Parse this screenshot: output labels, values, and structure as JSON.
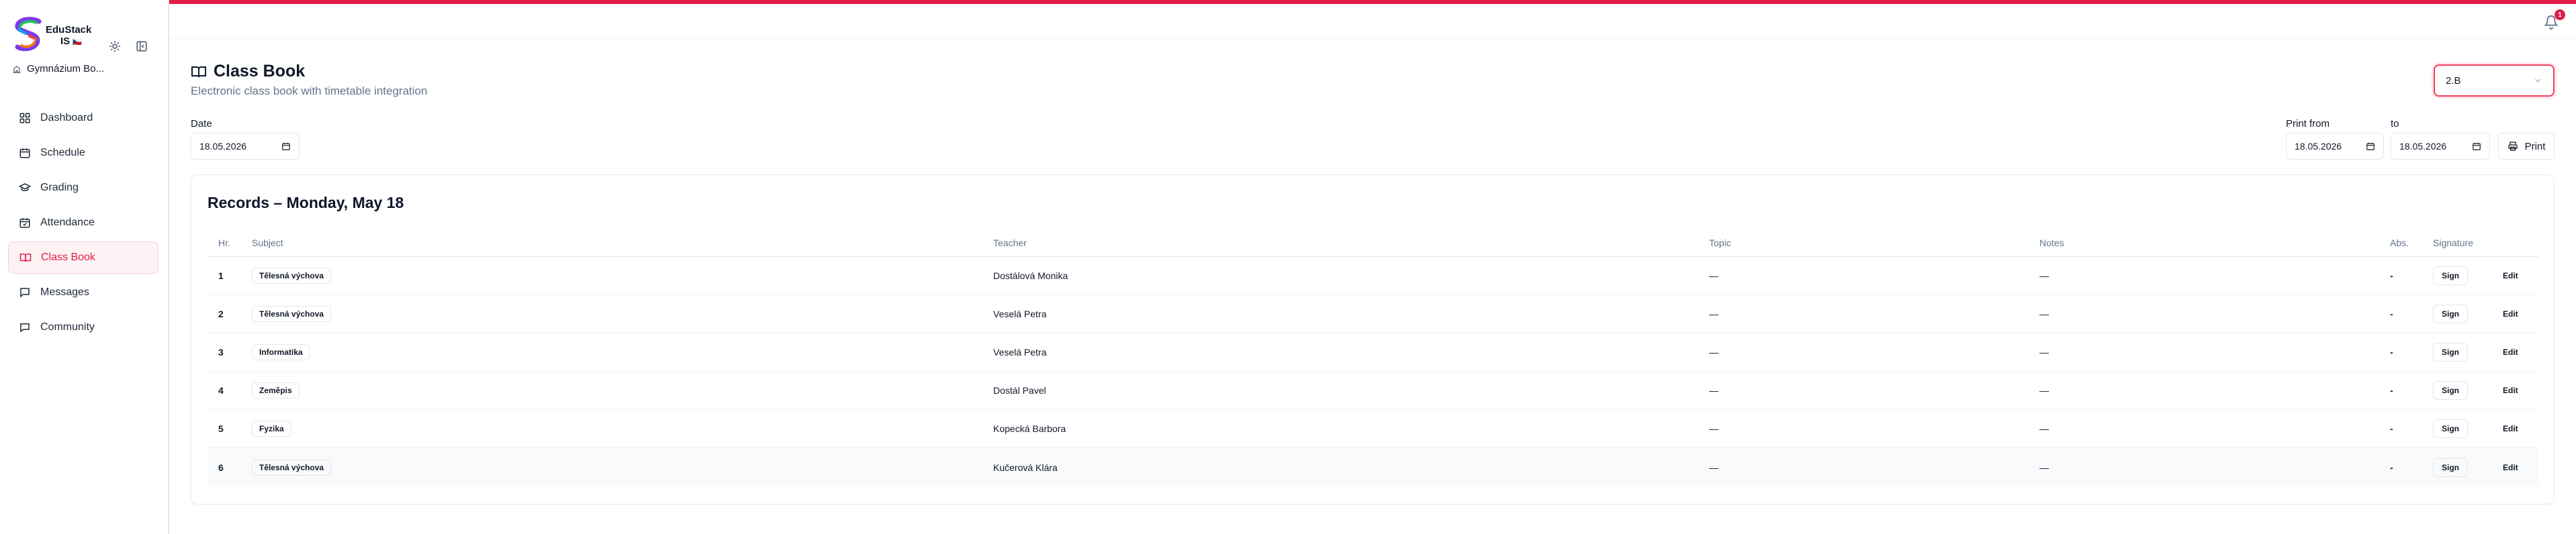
{
  "brand": {
    "name_line1": "EduStack",
    "name_line2": "IS",
    "flag": "🇨🇿"
  },
  "sidebar": {
    "school": "Gymnázium Bo...",
    "items": [
      {
        "label": "Dashboard",
        "icon": "dashboard-icon",
        "active": false
      },
      {
        "label": "Schedule",
        "icon": "calendar-icon",
        "active": false
      },
      {
        "label": "Grading",
        "icon": "graduation-cap-icon",
        "active": false
      },
      {
        "label": "Attendance",
        "icon": "calendar-check-icon",
        "active": false
      },
      {
        "label": "Class Book",
        "icon": "book-open-icon",
        "active": true
      },
      {
        "label": "Messages",
        "icon": "message-icon",
        "active": false
      },
      {
        "label": "Community",
        "icon": "message-circle-icon",
        "active": false
      }
    ]
  },
  "topbar": {
    "notification_count": "1"
  },
  "header": {
    "title": "Class Book",
    "subtitle": "Electronic class book with timetable integration",
    "class_select": "2.B"
  },
  "filters": {
    "date_label": "Date",
    "date_value": "18.05.2026",
    "print_from_label": "Print from",
    "print_from_value": "18.05.2026",
    "print_to_label": "to",
    "print_to_value": "18.05.2026",
    "print_label": "Print"
  },
  "records": {
    "title": "Records – Monday, May 18",
    "columns": {
      "hr": "Hr.",
      "subject": "Subject",
      "teacher": "Teacher",
      "topic": "Topic",
      "notes": "Notes",
      "abs": "Abs.",
      "signature": "Signature"
    },
    "rows": [
      {
        "hr": "1",
        "subject": "Tělesná výchova",
        "teacher": "Dostálová Monika",
        "topic": "—",
        "notes": "—",
        "abs": "-",
        "sign": "Sign",
        "edit": "Edit"
      },
      {
        "hr": "2",
        "subject": "Tělesná výchova",
        "teacher": "Veselá Petra",
        "topic": "—",
        "notes": "—",
        "abs": "-",
        "sign": "Sign",
        "edit": "Edit"
      },
      {
        "hr": "3",
        "subject": "Informatika",
        "teacher": "Veselá Petra",
        "topic": "—",
        "notes": "—",
        "abs": "-",
        "sign": "Sign",
        "edit": "Edit"
      },
      {
        "hr": "4",
        "subject": "Zeměpis",
        "teacher": "Dostál Pavel",
        "topic": "—",
        "notes": "—",
        "abs": "-",
        "sign": "Sign",
        "edit": "Edit"
      },
      {
        "hr": "5",
        "subject": "Fyzika",
        "teacher": "Kopecká Barbora",
        "topic": "—",
        "notes": "—",
        "abs": "-",
        "sign": "Sign",
        "edit": "Edit"
      },
      {
        "hr": "6",
        "subject": "Tělesná výchova",
        "teacher": "Kučerová Klára",
        "topic": "—",
        "notes": "—",
        "abs": "-",
        "sign": "Sign",
        "edit": "Edit"
      }
    ]
  },
  "colors": {
    "accent": "#e11d48",
    "active_bg": "#fdf2f4",
    "muted_text": "#64748b",
    "border": "#e5e7eb"
  }
}
